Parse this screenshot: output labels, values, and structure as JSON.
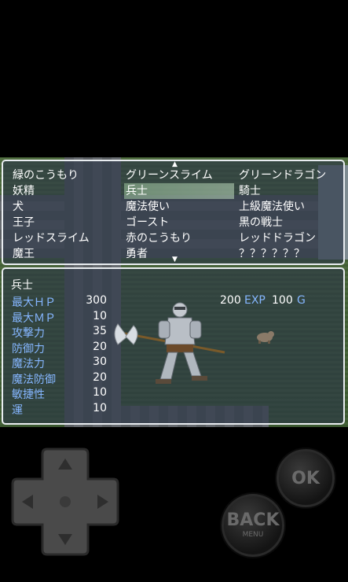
{
  "enemy_list": {
    "up_arrow": "▲",
    "down_arrow": "▼",
    "entries": [
      "緑のこうもり",
      "グリーンスライム",
      "グリーンドラゴン",
      "妖精",
      "兵士",
      "騎士",
      "犬",
      "魔法使い",
      "上級魔法使い",
      "王子",
      "ゴースト",
      "黒の戦士",
      "レッドスライム",
      "赤のこうもり",
      "レッドドラゴン",
      "魔王",
      "勇者",
      "？？？？？？"
    ],
    "selected_index": 4
  },
  "detail": {
    "name": "兵士",
    "stats": [
      {
        "label": "最大ＨＰ",
        "value": "300"
      },
      {
        "label": "最大ＭＰ",
        "value": "10"
      },
      {
        "label": "攻撃力",
        "value": "35"
      },
      {
        "label": "防御力",
        "value": "20"
      },
      {
        "label": "魔法力",
        "value": "30"
      },
      {
        "label": "魔法防御",
        "value": "20"
      },
      {
        "label": "敏捷性",
        "value": "10"
      },
      {
        "label": "運",
        "value": "10"
      }
    ],
    "exp_value": "200",
    "exp_label": "EXP",
    "gold_value": "100",
    "gold_label": "G"
  },
  "controls": {
    "ok_label": "OK",
    "back_label": "BACK",
    "menu_label": "MENU"
  }
}
